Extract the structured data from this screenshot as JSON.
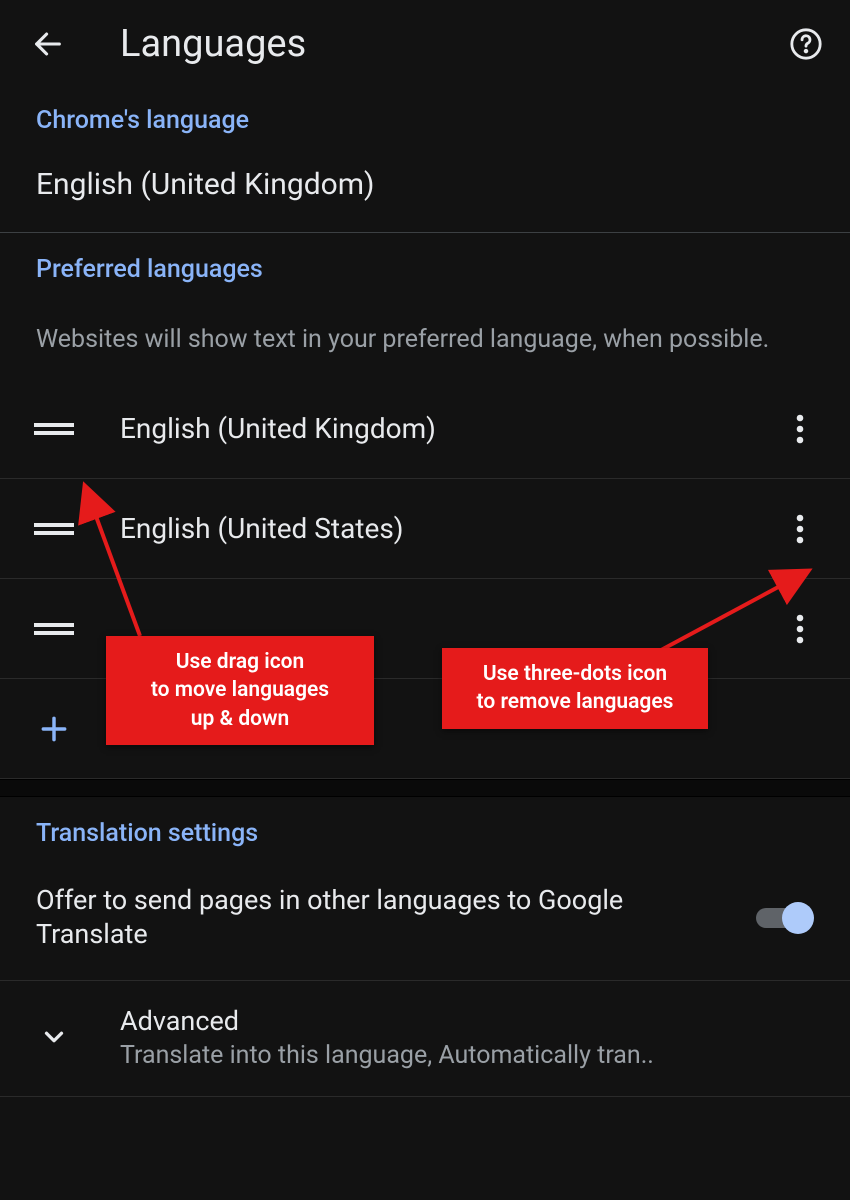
{
  "header": {
    "title": "Languages"
  },
  "sections": {
    "chrome_language": {
      "heading": "Chrome's language",
      "value": "English (United Kingdom)"
    },
    "preferred": {
      "heading": "Preferred languages",
      "description": "Websites will show text in your preferred language, when possible.",
      "items": [
        {
          "name": "English (United Kingdom)"
        },
        {
          "name": "English (United States)"
        },
        {
          "name": ""
        }
      ],
      "add_label": "Add language"
    },
    "translation": {
      "heading": "Translation settings",
      "toggle_label": "Offer to send pages in other languages to Google Translate",
      "advanced_title": "Advanced",
      "advanced_sub": "Translate into this language, Automatically tran.."
    }
  },
  "annotations": {
    "drag_callout": "Use drag icon\nto move languages\nup & down",
    "dots_callout": "Use three-dots icon\nto remove languages"
  }
}
